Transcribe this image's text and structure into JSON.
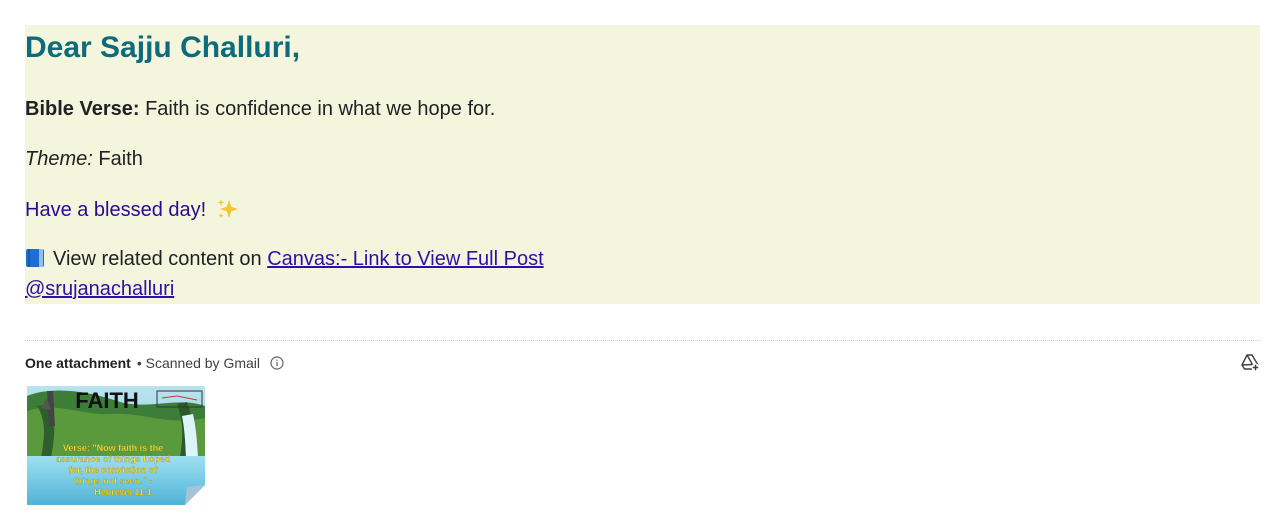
{
  "email": {
    "greeting": "Dear Sajju Challuri,",
    "verse_label": "Bible Verse:",
    "verse_text": " Faith is confidence in what we hope for.",
    "theme_label": "Theme:",
    "theme_text": " Faith",
    "blessing_text": "Have a blessed day!",
    "content_prefix": "View related content on ",
    "content_link": "Canvas:- Link to View Full Post",
    "handle_link": "@srujanachalluri"
  },
  "attachments": {
    "count_label": "One attachment",
    "scanned_label": "• Scanned by Gmail",
    "add_to_drive_icon": "add-to-drive-icon",
    "thumbnail": {
      "title": "FAITH",
      "caption_lines": [
        "Verse: \"Now faith is the",
        "assurance of things hoped",
        "for, the conviction of",
        "things not seen.\" -",
        "Hebrews 11:1"
      ]
    }
  },
  "colors": {
    "greeting": "#0e6b7c",
    "body_background": "#f3f6dc",
    "link": "#2f0fa8"
  }
}
